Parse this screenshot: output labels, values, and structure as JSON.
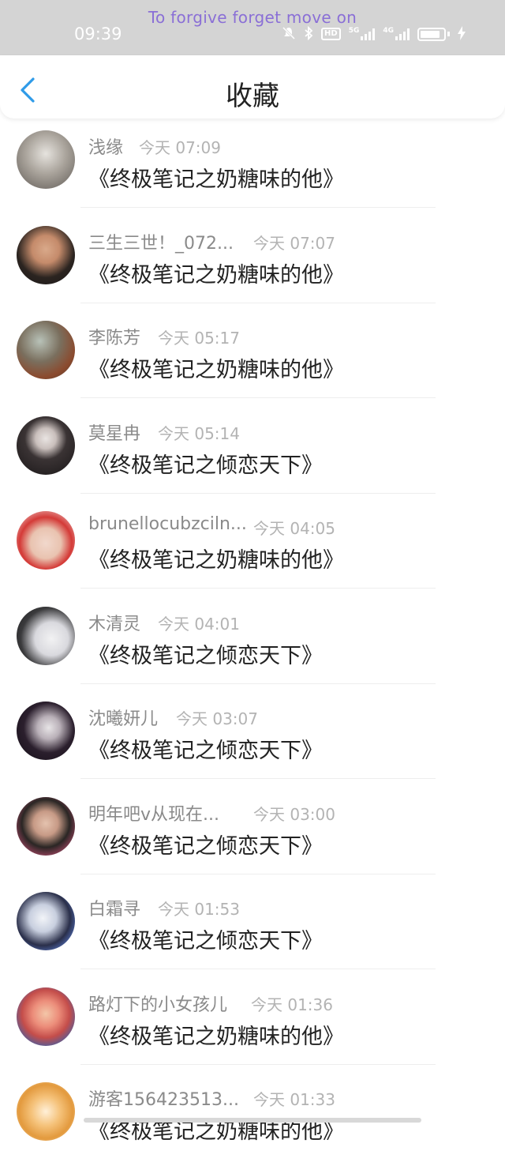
{
  "status_bar": {
    "motto": "To forgive  forget  move on",
    "time": "09:39",
    "icons": [
      "mute-icon",
      "bluetooth-icon",
      "hd-icon",
      "5g-signal-icon",
      "4g-signal-icon",
      "battery-icon",
      "charging-icon"
    ],
    "hd_label": "HD",
    "net1": "5G",
    "net2": "4G"
  },
  "header": {
    "title": "收藏",
    "back_icon": "chevron-left-icon",
    "accent_color": "#2f9be8"
  },
  "items": [
    {
      "user": "浅缘",
      "time": "今天 07:09",
      "book": "《终极笔记之奶糖味的他》"
    },
    {
      "user": "三生三世！_072...",
      "time": "今天 07:07",
      "book": "《终极笔记之奶糖味的他》"
    },
    {
      "user": "李陈芳",
      "time": "今天 05:17",
      "book": "《终极笔记之奶糖味的他》"
    },
    {
      "user": "莫星冉",
      "time": "今天 05:14",
      "book": "《终极笔记之倾恋天下》"
    },
    {
      "user": "brunellocubzciln...",
      "time": "今天 04:05",
      "book": "《终极笔记之奶糖味的他》"
    },
    {
      "user": "木清灵",
      "time": "今天 04:01",
      "book": "《终极笔记之倾恋天下》"
    },
    {
      "user": "沈曦妍儿",
      "time": "今天 03:07",
      "book": "《终极笔记之倾恋天下》"
    },
    {
      "user": "明年吧v从现在...",
      "time": "今天 03:00",
      "book": "《终极笔记之倾恋天下》"
    },
    {
      "user": "白霜寻",
      "time": "今天 01:53",
      "book": "《终极笔记之倾恋天下》"
    },
    {
      "user": "路灯下的小女孩儿",
      "time": "今天 01:36",
      "book": "《终极笔记之奶糖味的他》"
    },
    {
      "user": "游客156423513...",
      "time": "今天 01:33",
      "book": "《终极笔记之奶糖味的他》"
    }
  ]
}
